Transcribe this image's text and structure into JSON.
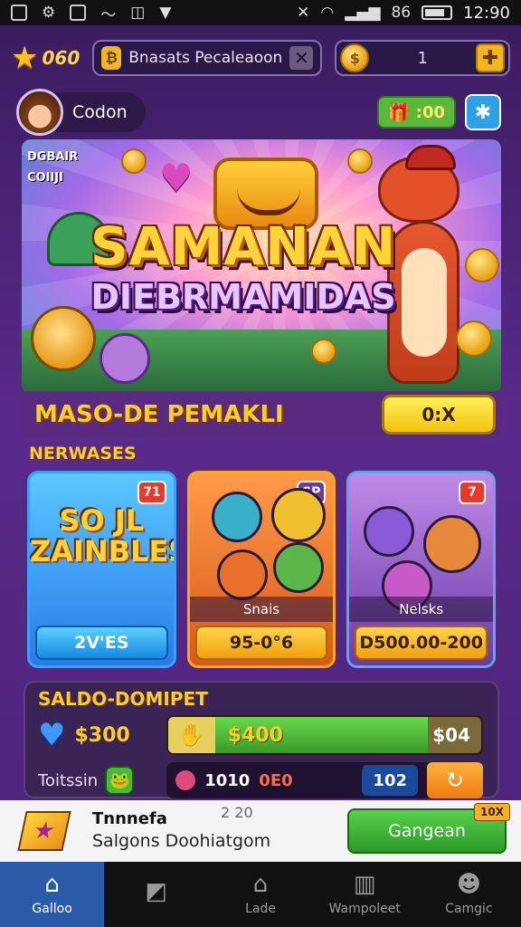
{
  "status_bar": {
    "left_icons": [
      "image-icon",
      "gear-icon",
      "note-icon",
      "wave-icon",
      "app-icon",
      "vpn-icon"
    ],
    "signal_text": "86",
    "time": "12:90"
  },
  "header": {
    "star_count": "060",
    "search": {
      "lead_icon": "coin-icon",
      "value": "Bnasats Pecaleaoon"
    },
    "coin_value": "1"
  },
  "profile": {
    "name": "Codon",
    "gift_label": ":00"
  },
  "hero": {
    "title_line1": "SAMANAN",
    "title_line2": "DIEBRMAMIDAS",
    "corner_label_1": "DGBAIR",
    "corner_label_2": "COIIJI"
  },
  "promo": {
    "title": "MASO-DE PEMAKLI",
    "button": "0:X"
  },
  "section_label": "NERWASES",
  "cards": [
    {
      "badge": "71",
      "art_text_line1": "SO JL",
      "art_text_line2": "ZAINBLES",
      "price": "2V'ES"
    },
    {
      "badge": "SP",
      "name": "Snais",
      "price": "95-0°6"
    },
    {
      "badge": "7",
      "name": "Nelsks",
      "price": "D500.00-200"
    }
  ],
  "balance": {
    "title": "SALDO-DOMIPET",
    "amount": "$300",
    "bar_value": "$400",
    "bar_end": "$04",
    "bar_fill": 0.83,
    "row2_label": "Toitssin",
    "row2_value_a": "1010",
    "row2_value_b": "0E0",
    "row2_tag": "102"
  },
  "notification": {
    "title": "Tnnnefa",
    "subtitle": "Salgons Doohiatgom",
    "mini": "2 20",
    "button": "Gangean",
    "button_badge": "10X"
  },
  "bottom_nav": [
    {
      "label": "Galloo",
      "icon": "home-icon",
      "active": true
    },
    {
      "label": "",
      "icon": "cards-icon",
      "active": false
    },
    {
      "label": "Lade",
      "icon": "house-icon",
      "active": false
    },
    {
      "label": "Wampoleet",
      "icon": "book-icon",
      "active": false
    },
    {
      "label": "Camgic",
      "icon": "person-icon",
      "active": false
    }
  ]
}
